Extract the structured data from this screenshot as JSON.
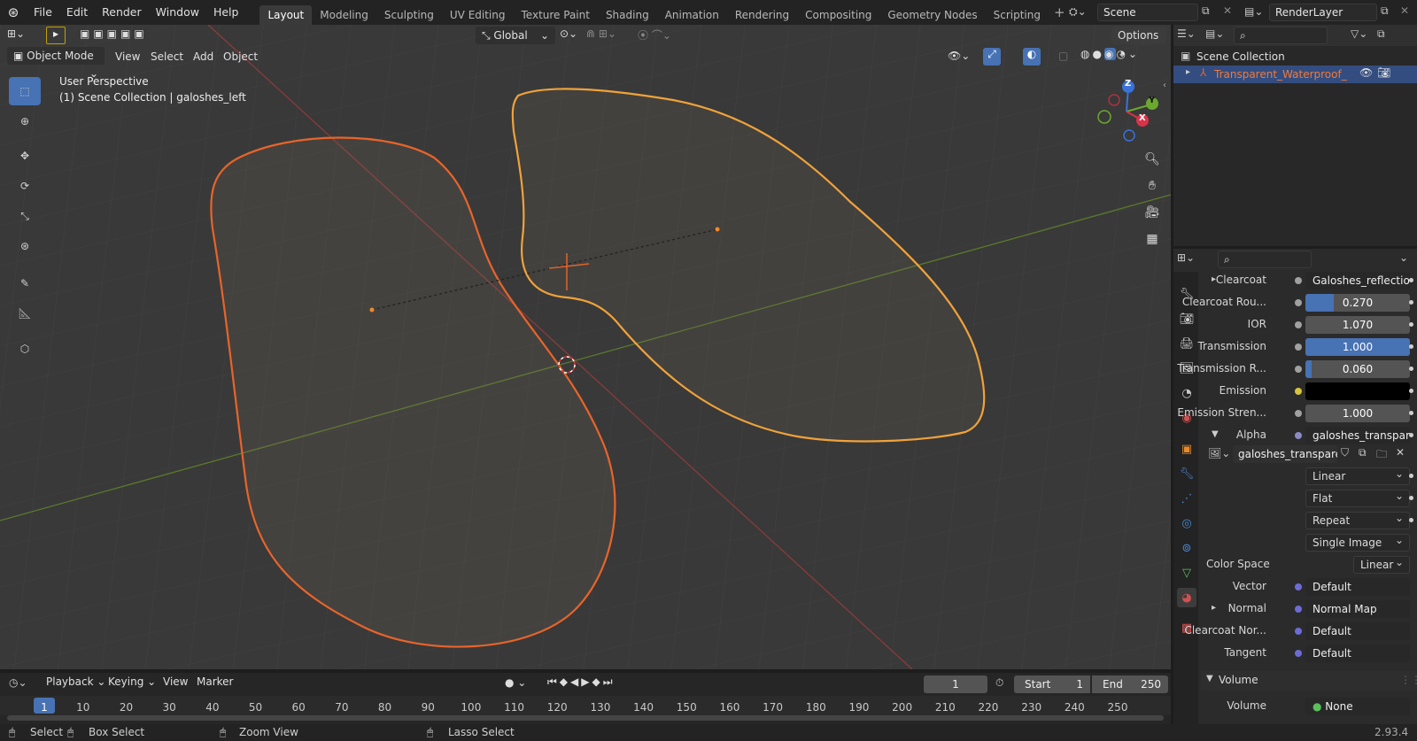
{
  "topbar": {
    "menus": [
      "File",
      "Edit",
      "Render",
      "Window",
      "Help"
    ],
    "workspaces": [
      "Layout",
      "Modeling",
      "Sculpting",
      "UV Editing",
      "Texture Paint",
      "Shading",
      "Animation",
      "Rendering",
      "Compositing",
      "Geometry Nodes",
      "Scripting"
    ],
    "active_workspace": "Layout",
    "scene": "Scene",
    "view_layer": "RenderLayer"
  },
  "viewport": {
    "mode": "Object Mode",
    "menus": [
      "View",
      "Select",
      "Add",
      "Object"
    ],
    "orientation": "Global",
    "options": "Options",
    "overlay_title": "User Perspective",
    "overlay_sub": "(1) Scene Collection | galoshes_left",
    "gizmo": {
      "x": "X",
      "y": "Y",
      "z": "Z"
    }
  },
  "outliner": {
    "root": "Scene Collection",
    "item": "Transparent_Waterproof_Galc"
  },
  "properties": {
    "rows": [
      {
        "label": "Clearcoat",
        "kind": "link",
        "value": "Galoshes_reflectio...",
        "dot": "#a0a0a0",
        "expand": true
      },
      {
        "label": "Clearcoat Rou...",
        "kind": "num",
        "value": "0.270",
        "fill": 0.27
      },
      {
        "label": "IOR",
        "kind": "num",
        "value": "1.070",
        "fill": 0
      },
      {
        "label": "Transmission",
        "kind": "num",
        "value": "1.000",
        "fill": 1.0
      },
      {
        "label": "Transmission R...",
        "kind": "num",
        "value": "0.060",
        "fill": 0.06
      },
      {
        "label": "Emission",
        "kind": "color",
        "value": "#000000",
        "dot": "#d6c33a"
      },
      {
        "label": "Emission Stren...",
        "kind": "num",
        "value": "1.000",
        "fill": 0
      },
      {
        "label": "Alpha",
        "kind": "link",
        "value": "galoshes_transpar...",
        "dot": "#8a8ac8",
        "collapse": true
      }
    ],
    "image_name": "galoshes_transparen...",
    "interp": "Linear",
    "projection": "Flat",
    "extension": "Repeat",
    "source": "Single Image",
    "color_space_label": "Color Space",
    "color_space": "Linear",
    "rows2": [
      {
        "label": "Vector",
        "value": "Default"
      },
      {
        "label": "Normal",
        "value": "Normal Map",
        "expand": true
      },
      {
        "label": "Clearcoat Nor...",
        "value": "Default"
      },
      {
        "label": "Tangent",
        "value": "Default"
      }
    ],
    "volume_panel": "Volume",
    "volume_label": "Volume",
    "volume_value": "None"
  },
  "timeline": {
    "menus": [
      "Playback",
      "Keying",
      "View",
      "Marker"
    ],
    "current_frame": "1",
    "start_label": "Start",
    "start": "1",
    "end_label": "End",
    "end": "250",
    "ticks": [
      "1",
      "10",
      "20",
      "30",
      "40",
      "50",
      "60",
      "70",
      "80",
      "90",
      "100",
      "110",
      "120",
      "130",
      "140",
      "150",
      "160",
      "170",
      "180",
      "190",
      "200",
      "210",
      "220",
      "230",
      "240",
      "250"
    ]
  },
  "statusbar": {
    "select": "Select",
    "box_select": "Box Select",
    "zoom_view": "Zoom View",
    "lasso_select": "Lasso Select",
    "version": "2.93.4"
  }
}
